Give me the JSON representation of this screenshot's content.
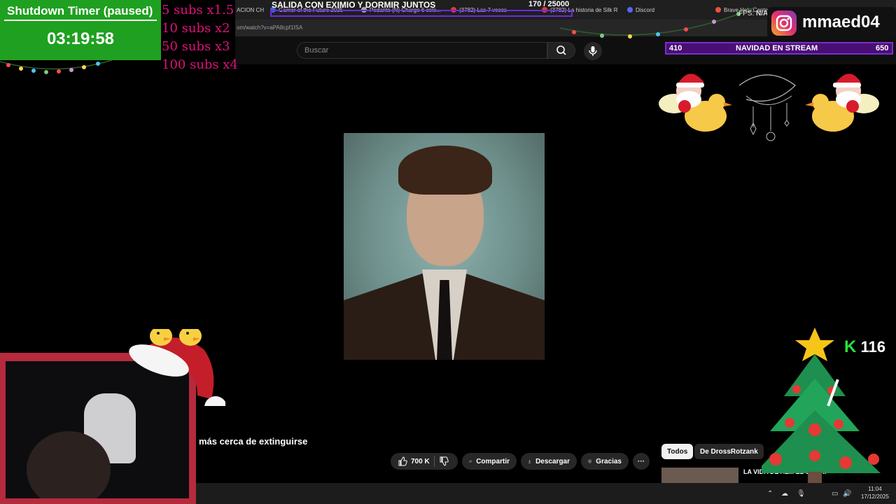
{
  "timer": {
    "title": "Shutdown Timer (paused)",
    "value": "03:19:58"
  },
  "subs_multipliers": [
    "5 subs x1.5",
    "10 subs x2",
    "50 subs x3",
    "100 subs x4"
  ],
  "goal": {
    "title": "SALIDA CON EXIMIO Y DORMIR JUNTOS",
    "count": "170   / 25000"
  },
  "browser": {
    "tabs": [
      "ACION CH",
      "Gamer of the Future 2025",
      "Pedante (N) Charge 6 cele...",
      "(3782) Las 7 veces",
      "(3782) La historia de Silk R",
      "Discord",
      "Brave Help Center"
    ],
    "url": "om/watch?v=aPA8cpf1ISA"
  },
  "youtube": {
    "search_placeholder": "Buscar",
    "video_title": "más cerca de extinguirse",
    "likes": "700 K",
    "share_label": "Compartir",
    "download_label": "Descargar",
    "thanks_label": "Gracias",
    "more_label": "···",
    "chips": [
      "Todos",
      "De DrossRotzank"
    ],
    "rec_title": "LA VIDA DE AL... EL UMOR!"
  },
  "instagram": {
    "handle": "mmaed04"
  },
  "fps": {
    "label": "FPS:",
    "value": "N/A"
  },
  "event_bar": {
    "left": "410",
    "center": "NAVIDAD EN STREAM",
    "right": "650"
  },
  "kick": {
    "count": "116"
  },
  "taskbar": {
    "time": "11:04",
    "date": "17/12/2025"
  },
  "colors": {
    "timer_bg": "#1fa020",
    "subs_text": "#e0117a",
    "event_bar": "#4a0f73",
    "kick_green": "#27e23c"
  }
}
